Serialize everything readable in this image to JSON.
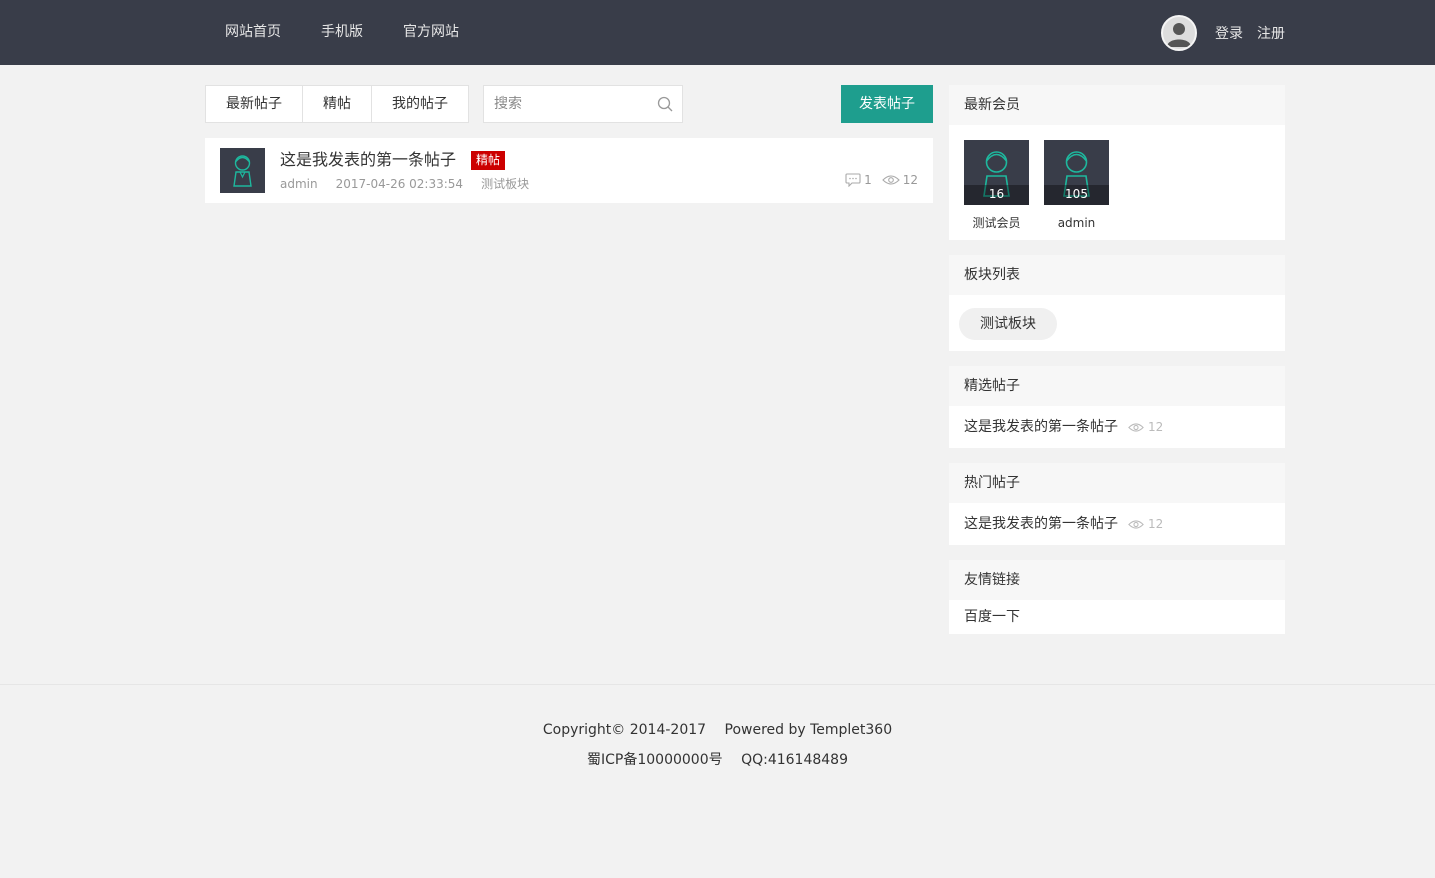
{
  "header": {
    "nav": [
      "网站首页",
      "手机版",
      "官方网站"
    ],
    "login": "登录",
    "register": "注册"
  },
  "toolbar": {
    "tabs": [
      "最新帖子",
      "精帖",
      "我的帖子"
    ],
    "search_placeholder": "搜索",
    "post_button": "发表帖子"
  },
  "posts": [
    {
      "title": "这是我发表的第一条帖子",
      "badge": "精帖",
      "author": "admin",
      "time": "2017-04-26 02:33:54",
      "board": "测试板块",
      "comments": "1",
      "views": "12"
    }
  ],
  "sidebar": {
    "members_title": "最新会员",
    "members": [
      {
        "name": "测试会员",
        "count": "16"
      },
      {
        "name": "admin",
        "count": "105"
      }
    ],
    "boards_title": "板块列表",
    "boards": [
      "测试板块"
    ],
    "featured_title": "精选帖子",
    "featured": [
      {
        "title": "这是我发表的第一条帖子",
        "views": "12"
      }
    ],
    "hot_title": "热门帖子",
    "hot": [
      {
        "title": "这是我发表的第一条帖子",
        "views": "12"
      }
    ],
    "links_title": "友情链接",
    "links": [
      "百度一下"
    ]
  },
  "footer": {
    "copyright": "Copyright© 2014-2017",
    "powered": "Powered by Templet360",
    "icp": "蜀ICP备10000000号",
    "qq": "QQ:416148489"
  },
  "colors": {
    "header_bg": "#393d49",
    "accent": "#1e9e8e",
    "badge": "#cc0000"
  }
}
